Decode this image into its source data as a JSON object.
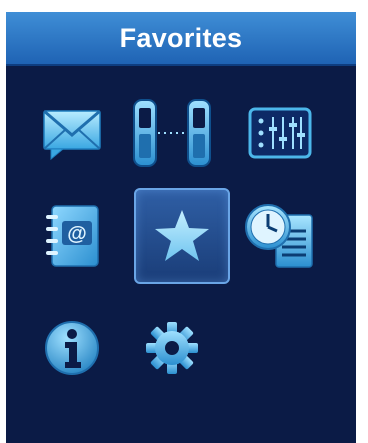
{
  "header": {
    "title": "Favorites"
  },
  "grid": {
    "selected_index": 4,
    "items": [
      {
        "icon": "envelope-icon"
      },
      {
        "icon": "paired-phones-icon"
      },
      {
        "icon": "equalizer-icon"
      },
      {
        "icon": "address-book-icon"
      },
      {
        "icon": "star-icon"
      },
      {
        "icon": "clock-document-icon"
      },
      {
        "icon": "info-icon"
      },
      {
        "icon": "gear-icon"
      }
    ]
  },
  "colors": {
    "screen_bg": "#0b1b46",
    "titlebar_top": "#3f8ed6",
    "titlebar_bottom": "#1f63b4",
    "icon_light": "#9fe0ff",
    "icon_mid": "#4cb7ea",
    "icon_dark": "#1f7fc0",
    "selected_border": "#6aa5e6"
  }
}
